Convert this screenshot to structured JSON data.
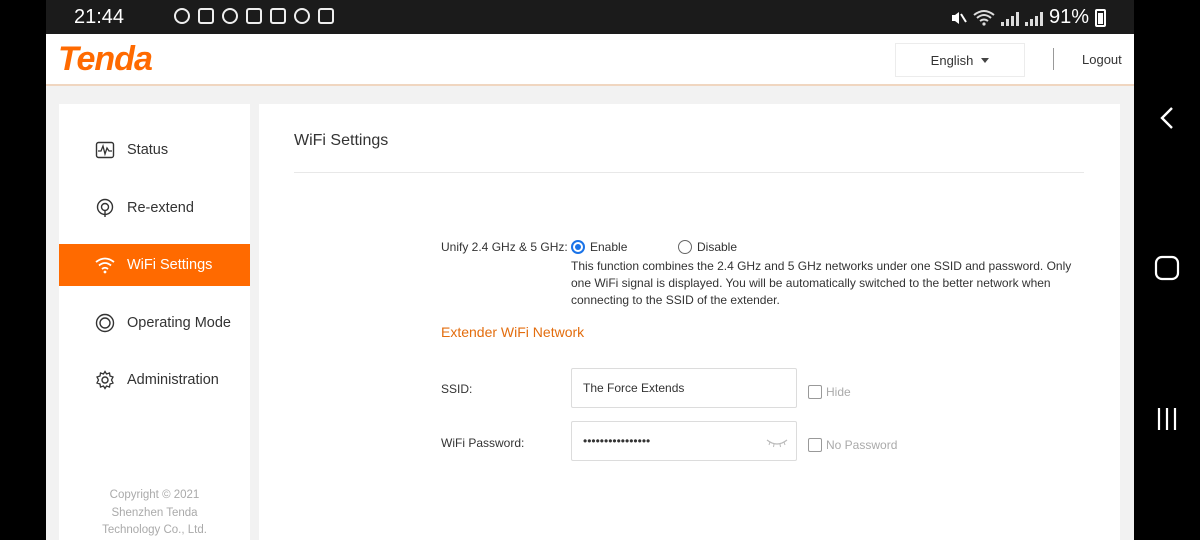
{
  "statusbar": {
    "time": "21:44",
    "battery": "91%"
  },
  "header": {
    "logo": "Tenda",
    "language": "English",
    "logout": "Logout"
  },
  "sidebar": {
    "items": [
      {
        "label": "Status",
        "icon": "pulse-icon"
      },
      {
        "label": "Re-extend",
        "icon": "re-extend-icon"
      },
      {
        "label": "WiFi Settings",
        "icon": "wifi-icon",
        "active": true
      },
      {
        "label": "Operating Mode",
        "icon": "operating-mode-icon"
      },
      {
        "label": "Administration",
        "icon": "gear-icon"
      }
    ],
    "copyright": [
      "Copyright © 2021",
      "Shenzhen Tenda",
      "Technology Co., Ltd."
    ]
  },
  "content": {
    "title": "WiFi Settings",
    "unify_label": "Unify 2.4 GHz & 5 GHz:",
    "enable_label": "Enable",
    "disable_label": "Disable",
    "unify_selected": "Enable",
    "unify_description": "This function combines the 2.4 GHz and 5 GHz networks under one SSID and password. Only one WiFi signal is displayed. You will be automatically switched to the better network when connecting to the SSID of the extender.",
    "section_title": "Extender WiFi Network",
    "ssid_label": "SSID:",
    "ssid_value": "The Force Extends",
    "hide_label": "Hide",
    "password_label": "WiFi Password:",
    "password_value": "••••••••••••••••",
    "no_password_label": "No Password"
  },
  "colors": {
    "accent": "#ff6a00",
    "section": "#e36d0e",
    "radio": "#1a73e8"
  }
}
